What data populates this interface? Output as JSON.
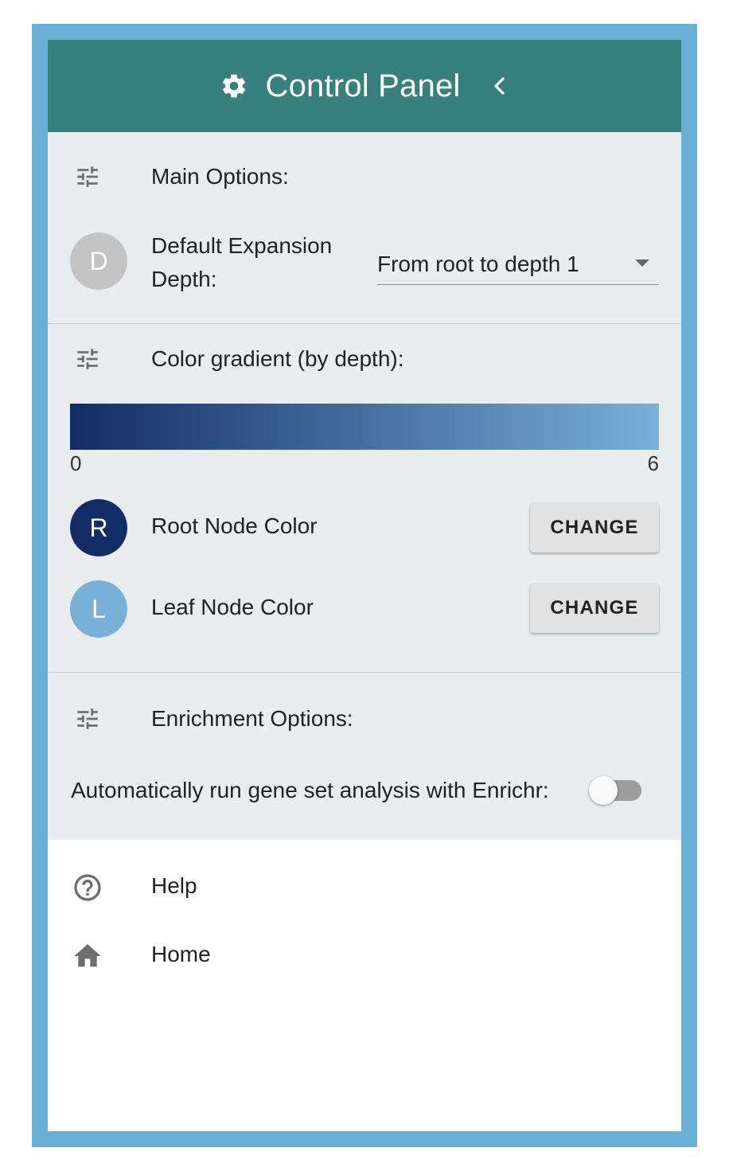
{
  "header": {
    "title": "Control Panel",
    "icons": {
      "settings": "gear-icon",
      "collapse": "chevron-left-icon"
    }
  },
  "main_options": {
    "heading": "Main Options:",
    "icon": "tune-icon",
    "depth_setting": {
      "avatar_letter": "D",
      "label": "Default Expansion Depth:",
      "selected_value": "From root to depth 1"
    }
  },
  "color_gradient": {
    "heading": "Color gradient (by depth):",
    "icon": "tune-icon",
    "min_label": "0",
    "max_label": "6",
    "start_color": "#142c66",
    "end_color": "#79b0d8",
    "root_node": {
      "avatar_letter": "R",
      "label": "Root Node Color",
      "button_label": "CHANGE",
      "color": "#142c66"
    },
    "leaf_node": {
      "avatar_letter": "L",
      "label": "Leaf Node Color",
      "button_label": "CHANGE",
      "color": "#79b0d8"
    }
  },
  "enrichment_options": {
    "heading": "Enrichment Options:",
    "icon": "tune-icon",
    "auto_run_label": "Automatically run gene set analysis with Enrichr:",
    "auto_run_enabled": false
  },
  "footer_menu": [
    {
      "label": "Help",
      "icon": "help-circle-icon"
    },
    {
      "label": "Home",
      "icon": "home-icon"
    }
  ],
  "colors": {
    "header_bg": "#37807b",
    "frame_border": "#6baed6",
    "section_bg": "#e9edf0",
    "depth_avatar": "#c4c4c4"
  }
}
